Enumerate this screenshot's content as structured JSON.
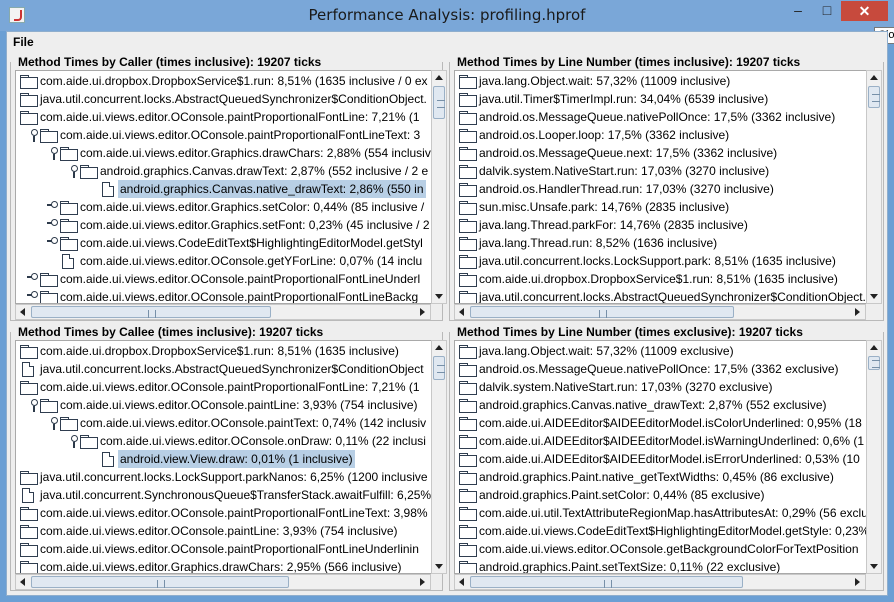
{
  "window": {
    "title": "Performance Analysis: profiling.hprof",
    "minimize_glyph": "–",
    "maximize_glyph": "□",
    "close_glyph": "✕",
    "tooltip_stub": "Clo"
  },
  "menu": {
    "file": "File"
  },
  "panels": {
    "caller": {
      "title": "Method Times by Caller (times inclusive): 19207 ticks",
      "rows": [
        {
          "indent": 0,
          "fold": "none",
          "icon": "folder",
          "text": "com.aide.ui.dropbox.DropboxService$1.run: 8,51% (1635 inclusive / 0 ex",
          "selected": false
        },
        {
          "indent": 0,
          "fold": "none",
          "icon": "folder",
          "text": "java.util.concurrent.locks.AbstractQueuedSynchronizer$ConditionObject.",
          "selected": false
        },
        {
          "indent": 0,
          "fold": "none",
          "icon": "folder",
          "text": "com.aide.ui.views.editor.OConsole.paintProportionalFontLine: 7,21% (1",
          "selected": false
        },
        {
          "indent": 1,
          "fold": "open",
          "icon": "folder",
          "text": "com.aide.ui.views.editor.OConsole.paintProportionalFontLineText: 3",
          "selected": false
        },
        {
          "indent": 2,
          "fold": "open",
          "icon": "folder",
          "text": "com.aide.ui.views.editor.Graphics.drawChars: 2,88% (554 inclusive",
          "selected": false
        },
        {
          "indent": 3,
          "fold": "open",
          "icon": "folder",
          "text": "android.graphics.Canvas.drawText: 2,87% (552 inclusive / 2 e",
          "selected": false
        },
        {
          "indent": 4,
          "fold": "none",
          "icon": "leaf",
          "text": "android.graphics.Canvas.native_drawText: 2,86% (550 in",
          "selected": true
        },
        {
          "indent": 2,
          "fold": "closed",
          "icon": "folder",
          "text": "com.aide.ui.views.editor.Graphics.setColor: 0,44% (85 inclusive /",
          "selected": false
        },
        {
          "indent": 2,
          "fold": "closed",
          "icon": "folder",
          "text": "com.aide.ui.views.editor.Graphics.setFont: 0,23% (45 inclusive / 2",
          "selected": false
        },
        {
          "indent": 2,
          "fold": "closed",
          "icon": "folder",
          "text": "com.aide.ui.views.CodeEditText$HighlightingEditorModel.getStyl",
          "selected": false
        },
        {
          "indent": 2,
          "fold": "none",
          "icon": "leaf",
          "text": "com.aide.ui.views.editor.OConsole.getYForLine: 0,07% (14 inclu",
          "selected": false
        },
        {
          "indent": 1,
          "fold": "closed",
          "icon": "folder",
          "text": "com.aide.ui.views.editor.OConsole.paintProportionalFontLineUnderl",
          "selected": false
        },
        {
          "indent": 1,
          "fold": "closed",
          "icon": "folder",
          "text": "com.aide.ui.views.editor.OConsole.paintProportionalFontLineBackg",
          "selected": false
        }
      ]
    },
    "line_incl": {
      "title": "Method Times by Line Number (times inclusive): 19207 ticks",
      "rows": [
        {
          "indent": 0,
          "fold": "none",
          "icon": "folder",
          "text": "java.lang.Object.wait: 57,32% (11009 inclusive)",
          "selected": false
        },
        {
          "indent": 0,
          "fold": "none",
          "icon": "folder",
          "text": "java.util.Timer$TimerImpl.run: 34,04% (6539 inclusive)",
          "selected": false
        },
        {
          "indent": 0,
          "fold": "none",
          "icon": "folder",
          "text": "android.os.MessageQueue.nativePollOnce: 17,5% (3362 inclusive)",
          "selected": false
        },
        {
          "indent": 0,
          "fold": "none",
          "icon": "folder",
          "text": "android.os.Looper.loop: 17,5% (3362 inclusive)",
          "selected": false
        },
        {
          "indent": 0,
          "fold": "none",
          "icon": "folder",
          "text": "android.os.MessageQueue.next: 17,5% (3362 inclusive)",
          "selected": false
        },
        {
          "indent": 0,
          "fold": "none",
          "icon": "folder",
          "text": "dalvik.system.NativeStart.run: 17,03% (3270 inclusive)",
          "selected": false
        },
        {
          "indent": 0,
          "fold": "none",
          "icon": "folder",
          "text": "android.os.HandlerThread.run: 17,03% (3270 inclusive)",
          "selected": false
        },
        {
          "indent": 0,
          "fold": "none",
          "icon": "folder",
          "text": "sun.misc.Unsafe.park: 14,76% (2835 inclusive)",
          "selected": false
        },
        {
          "indent": 0,
          "fold": "none",
          "icon": "folder",
          "text": "java.lang.Thread.parkFor: 14,76% (2835 inclusive)",
          "selected": false
        },
        {
          "indent": 0,
          "fold": "none",
          "icon": "folder",
          "text": "java.lang.Thread.run: 8,52% (1636 inclusive)",
          "selected": false
        },
        {
          "indent": 0,
          "fold": "none",
          "icon": "folder",
          "text": "java.util.concurrent.locks.LockSupport.park: 8,51% (1635 inclusive)",
          "selected": false
        },
        {
          "indent": 0,
          "fold": "none",
          "icon": "folder",
          "text": "com.aide.ui.dropbox.DropboxService$1.run: 8,51% (1635 inclusive)",
          "selected": false
        },
        {
          "indent": 0,
          "fold": "none",
          "icon": "folder",
          "text": "java.util.concurrent.locks.AbstractQueuedSynchronizer$ConditionObject.",
          "selected": false
        }
      ]
    },
    "callee": {
      "title": "Method Times by Callee (times inclusive): 19207 ticks",
      "rows": [
        {
          "indent": 0,
          "fold": "none",
          "icon": "folder",
          "text": "com.aide.ui.dropbox.DropboxService$1.run: 8,51% (1635 inclusive)",
          "selected": false
        },
        {
          "indent": 0,
          "fold": "none",
          "icon": "leaf",
          "text": "java.util.concurrent.locks.AbstractQueuedSynchronizer$ConditionObject",
          "selected": false
        },
        {
          "indent": 0,
          "fold": "none",
          "icon": "folder",
          "text": "com.aide.ui.views.editor.OConsole.paintProportionalFontLine: 7,21% (1",
          "selected": false
        },
        {
          "indent": 1,
          "fold": "open",
          "icon": "folder",
          "text": "com.aide.ui.views.editor.OConsole.paintLine: 3,93% (754 inclusive)",
          "selected": false
        },
        {
          "indent": 2,
          "fold": "open",
          "icon": "folder",
          "text": "com.aide.ui.views.editor.OConsole.paintText: 0,74% (142 inclusiv",
          "selected": false
        },
        {
          "indent": 3,
          "fold": "open",
          "icon": "folder",
          "text": "com.aide.ui.views.editor.OConsole.onDraw: 0,11% (22 inclusi",
          "selected": false
        },
        {
          "indent": 4,
          "fold": "none",
          "icon": "leaf",
          "text": "android.view.View.draw: 0,01% (1 inclusive)",
          "selected": true
        },
        {
          "indent": 0,
          "fold": "none",
          "icon": "folder",
          "text": "java.util.concurrent.locks.LockSupport.parkNanos: 6,25% (1200 inclusive",
          "selected": false
        },
        {
          "indent": 0,
          "fold": "none",
          "icon": "leaf",
          "text": "java.util.concurrent.SynchronousQueue$TransferStack.awaitFulfill: 6,25%",
          "selected": false
        },
        {
          "indent": 0,
          "fold": "none",
          "icon": "folder",
          "text": "com.aide.ui.views.editor.OConsole.paintProportionalFontLineText: 3,98%",
          "selected": false
        },
        {
          "indent": 0,
          "fold": "none",
          "icon": "folder",
          "text": "com.aide.ui.views.editor.OConsole.paintLine: 3,93% (754 inclusive)",
          "selected": false
        },
        {
          "indent": 0,
          "fold": "none",
          "icon": "folder",
          "text": "com.aide.ui.views.editor.OConsole.paintProportionalFontLineUnderlinin",
          "selected": false
        },
        {
          "indent": 0,
          "fold": "none",
          "icon": "folder",
          "text": "com.aide.ui.views.editor.Graphics.drawChars: 2,95% (566 inclusive)",
          "selected": false
        }
      ]
    },
    "line_excl": {
      "title": "Method Times by Line Number (times exclusive): 19207 ticks",
      "rows": [
        {
          "indent": 0,
          "fold": "none",
          "icon": "folder",
          "text": "java.lang.Object.wait: 57,32% (11009 exclusive)",
          "selected": false
        },
        {
          "indent": 0,
          "fold": "none",
          "icon": "folder",
          "text": "android.os.MessageQueue.nativePollOnce: 17,5% (3362 exclusive)",
          "selected": false
        },
        {
          "indent": 0,
          "fold": "none",
          "icon": "folder",
          "text": "dalvik.system.NativeStart.run: 17,03% (3270 exclusive)",
          "selected": false
        },
        {
          "indent": 0,
          "fold": "none",
          "icon": "folder",
          "text": "android.graphics.Canvas.native_drawText: 2,87% (552 exclusive)",
          "selected": false
        },
        {
          "indent": 0,
          "fold": "none",
          "icon": "folder",
          "text": "com.aide.ui.AIDEEditor$AIDEEditorModel.isColorUnderlined: 0,95% (18",
          "selected": false
        },
        {
          "indent": 0,
          "fold": "none",
          "icon": "folder",
          "text": "com.aide.ui.AIDEEditor$AIDEEditorModel.isWarningUnderlined: 0,6% (1",
          "selected": false
        },
        {
          "indent": 0,
          "fold": "none",
          "icon": "folder",
          "text": "com.aide.ui.AIDEEditor$AIDEEditorModel.isErrorUnderlined: 0,53% (10",
          "selected": false
        },
        {
          "indent": 0,
          "fold": "none",
          "icon": "folder",
          "text": "android.graphics.Paint.native_getTextWidths: 0,45% (86 exclusive)",
          "selected": false
        },
        {
          "indent": 0,
          "fold": "none",
          "icon": "folder",
          "text": "android.graphics.Paint.setColor: 0,44% (85 exclusive)",
          "selected": false
        },
        {
          "indent": 0,
          "fold": "none",
          "icon": "folder",
          "text": "com.aide.ui.util.TextAttributeRegionMap.hasAttributesAt: 0,29% (56 exclu",
          "selected": false
        },
        {
          "indent": 0,
          "fold": "none",
          "icon": "folder",
          "text": "com.aide.ui.views.CodeEditText$HighlightingEditorModel.getStyle: 0,23%",
          "selected": false
        },
        {
          "indent": 0,
          "fold": "none",
          "icon": "folder",
          "text": "com.aide.ui.views.editor.OConsole.getBackgroundColorForTextPosition",
          "selected": false
        },
        {
          "indent": 0,
          "fold": "none",
          "icon": "folder",
          "text": "android.graphics.Paint.setTextSize: 0,11% (22 exclusive)",
          "selected": false
        }
      ]
    }
  }
}
